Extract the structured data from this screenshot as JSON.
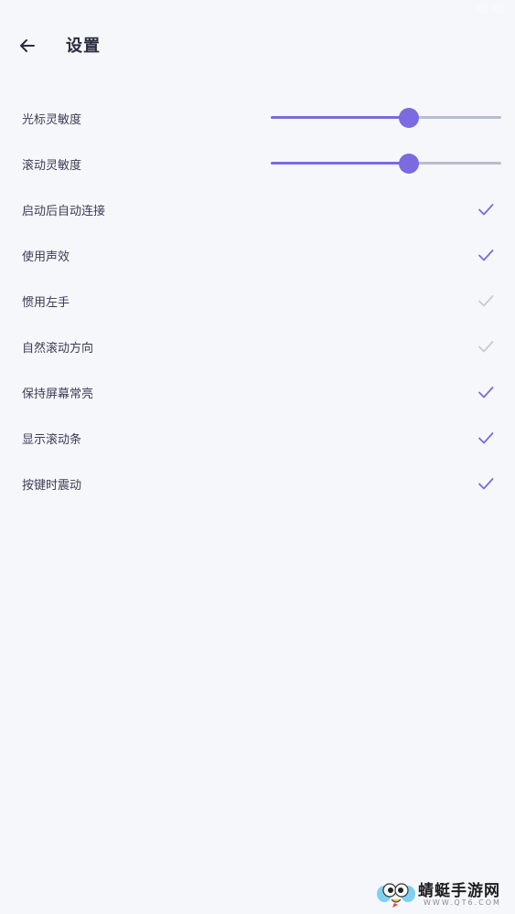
{
  "header": {
    "title": "设置",
    "back_icon": "arrow-left-icon"
  },
  "colors": {
    "accent": "#7b6ae0",
    "check_on": "#7b6ae0",
    "check_off": "#c8cad6",
    "background": "#f6f7fb"
  },
  "settings": {
    "sliders": [
      {
        "label": "光标灵敏度",
        "value_fraction": 0.6
      },
      {
        "label": "滚动灵敏度",
        "value_fraction": 0.6
      }
    ],
    "toggles": [
      {
        "label": "启动后自动连接",
        "checked": true
      },
      {
        "label": "使用声效",
        "checked": true
      },
      {
        "label": "惯用左手",
        "checked": false
      },
      {
        "label": "自然滚动方向",
        "checked": false
      },
      {
        "label": "保持屏幕常亮",
        "checked": true
      },
      {
        "label": "显示滚动条",
        "checked": true
      },
      {
        "label": "按键时震动",
        "checked": true
      }
    ]
  },
  "watermark": {
    "name": "蜻蜓手游网",
    "url": "WWW.QT6.COM"
  }
}
